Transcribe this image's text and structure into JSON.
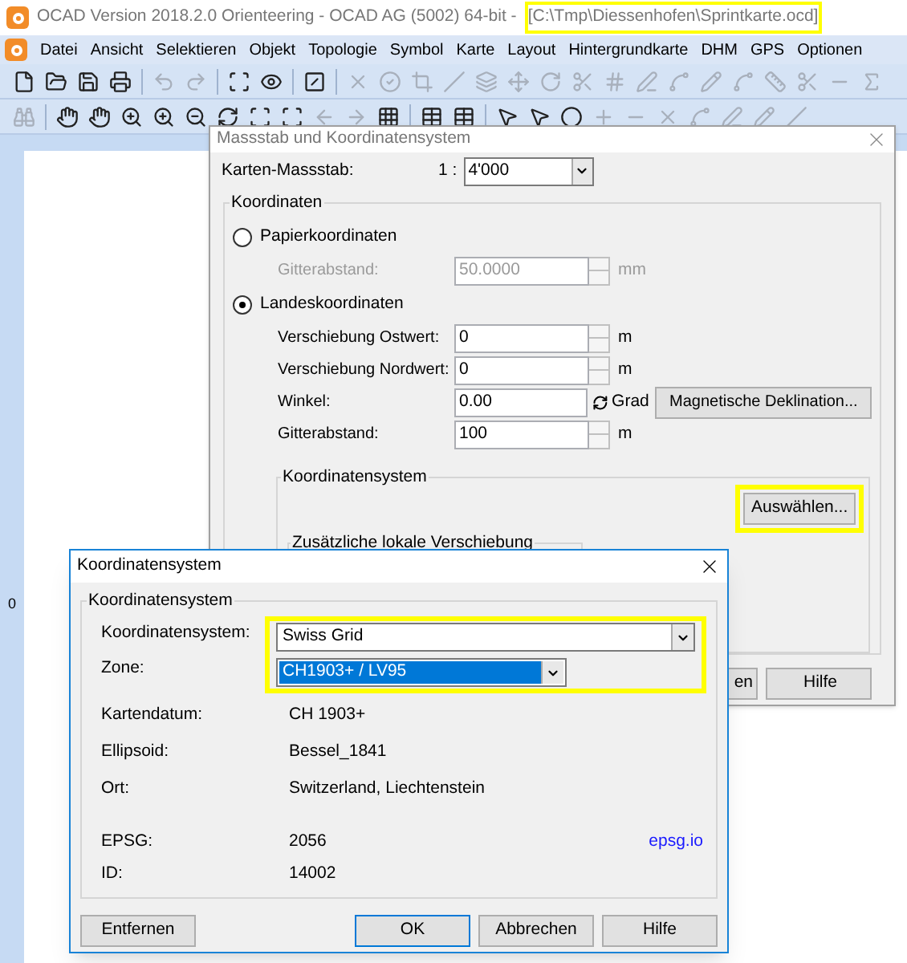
{
  "window": {
    "title": "OCAD Version 2018.2.0  Orienteering - OCAD AG (5002) 64-bit -",
    "file_path": "[C:\\Tmp\\Diessenhofen\\Sprintkarte.ocd]",
    "file_path_highlighted": true
  },
  "menu": [
    "Datei",
    "Ansicht",
    "Selektieren",
    "Objekt",
    "Topologie",
    "Symbol",
    "Karte",
    "Layout",
    "Hintergrundkarte",
    "DHM",
    "GPS",
    "Optionen"
  ],
  "ruler": {
    "label": "0"
  },
  "scale_dialog": {
    "title": "Massstab und Koordinatensystem",
    "active": false,
    "scale_label": "Karten-Massstab:",
    "scale_prefix": "1 :",
    "scale_value": "4'000",
    "group_title": "Koordinaten",
    "options": [
      {
        "label": "Papierkoordinaten",
        "selected": false,
        "fields": [
          {
            "kind": "spin",
            "label": "Gitterabstand:",
            "value": "50.0000",
            "unit": "mm",
            "disabled": true
          }
        ]
      },
      {
        "label": "Landeskoordinaten",
        "selected": true,
        "fields": [
          {
            "kind": "spin",
            "label": "Verschiebung Ostwert:",
            "value": "0",
            "unit": "m",
            "disabled": false
          },
          {
            "kind": "spin",
            "label": "Verschiebung Nordwert:",
            "value": "0",
            "unit": "m",
            "disabled": false
          },
          {
            "kind": "angle",
            "label": "Winkel:",
            "value": "0.00",
            "unit": "Grad",
            "button": "Magnetische Deklination...",
            "disabled": false
          },
          {
            "kind": "spin",
            "label": "Gitterabstand:",
            "value": "100",
            "unit": "m",
            "disabled": false
          }
        ]
      }
    ],
    "cs_group_title": "Koordinatensystem",
    "select_button": {
      "label": "Auswählen...",
      "highlighted": true
    },
    "offset_group_title": "Zusätzliche lokale Verschiebung",
    "buttons": [
      "en",
      "Hilfe"
    ]
  },
  "cs_dialog": {
    "title": "Koordinatensystem",
    "active": true,
    "group_title": "Koordinatensystem",
    "combos_highlighted": true,
    "system": {
      "label": "Koordinatensystem:",
      "value": "Swiss Grid"
    },
    "zone": {
      "label": "Zone:",
      "value": "CH1903+ / LV95",
      "selected": true
    },
    "info": [
      {
        "label": "Kartendatum:",
        "value": "CH 1903+"
      },
      {
        "label": "Ellipsoid:",
        "value": "Bessel_1841"
      },
      {
        "label": "Ort:",
        "value": "Switzerland, Liechtenstein"
      }
    ],
    "codes": [
      {
        "label": "EPSG:",
        "value": "2056",
        "link": "epsg.io"
      },
      {
        "label": "ID:",
        "value": "14002"
      }
    ],
    "remove_button": "Entfernen",
    "buttons": [
      {
        "label": "OK",
        "default": true
      },
      {
        "label": "Abbrechen",
        "default": false
      },
      {
        "label": "Hilfe",
        "default": false
      }
    ]
  }
}
